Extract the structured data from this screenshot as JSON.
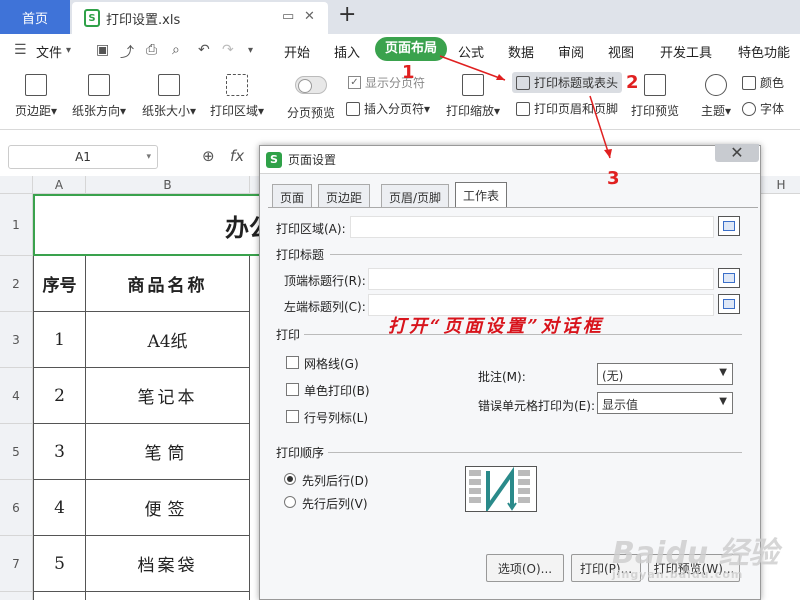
{
  "tabs": {
    "home": "首页",
    "doc": "打印设置.xls",
    "new_tab": "+"
  },
  "menu": {
    "file": "文件",
    "items": [
      "开始",
      "插入",
      "页面布局",
      "公式",
      "数据",
      "审阅",
      "视图",
      "开发工具",
      "特色功能"
    ]
  },
  "ribbon": {
    "margins": "页边距",
    "orientation": "纸张方向",
    "size": "纸张大小",
    "print_area": "打印区域",
    "page_break_preview": "分页预览",
    "show_page_breaks": "显示分页符",
    "insert_page_break": "插入分页符",
    "print_scale": "打印缩放",
    "print_titles": "打印标题或表头",
    "print_header_footer": "打印页眉和页脚",
    "print_preview": "打印预览",
    "theme": "主题",
    "colors": "颜色",
    "font": "字体"
  },
  "formula_bar": {
    "cell_ref": "A1",
    "fx": "fx"
  },
  "sheet": {
    "columns": [
      "A",
      "B",
      "H"
    ],
    "rows": [
      "1",
      "2",
      "3",
      "4",
      "5",
      "6",
      "7"
    ],
    "title_fragment": "办公",
    "headers": [
      "序号",
      "商品名称"
    ],
    "data": [
      [
        "1",
        "A4纸"
      ],
      [
        "2",
        "笔记本"
      ],
      [
        "3",
        "笔筒"
      ],
      [
        "4",
        "便签"
      ],
      [
        "5",
        "档案袋"
      ]
    ]
  },
  "dialog": {
    "title": "页面设置",
    "close": "✕",
    "tabs": [
      "页面",
      "页边距",
      "页眉/页脚",
      "工作表"
    ],
    "print_area_label": "打印区域(A):",
    "print_titles_section": "打印标题",
    "top_rows_label": "顶端标题行(R):",
    "left_cols_label": "左端标题列(C):",
    "print_section": "打印",
    "gridlines": "网格线(G)",
    "mono": "单色打印(B)",
    "row_col_headers": "行号列标(L)",
    "comments_label": "批注(M):",
    "comments_value": "(无)",
    "errors_label": "错误单元格打印为(E):",
    "errors_value": "显示值",
    "order_section": "打印顺序",
    "down_then_over": "先列后行(D)",
    "over_then_down": "先行后列(V)",
    "btn_options": "选项(O)...",
    "btn_print": "打印(P)...",
    "btn_preview": "打印预览(W)..."
  },
  "annotations": {
    "n1": "1",
    "n2": "2",
    "n3": "3",
    "caption": "打开“页面设置”对话框",
    "annotation_color": "#e02020"
  },
  "colors": {
    "accent_green": "#3aa24d",
    "home_tab_blue": "#3f73d8"
  }
}
